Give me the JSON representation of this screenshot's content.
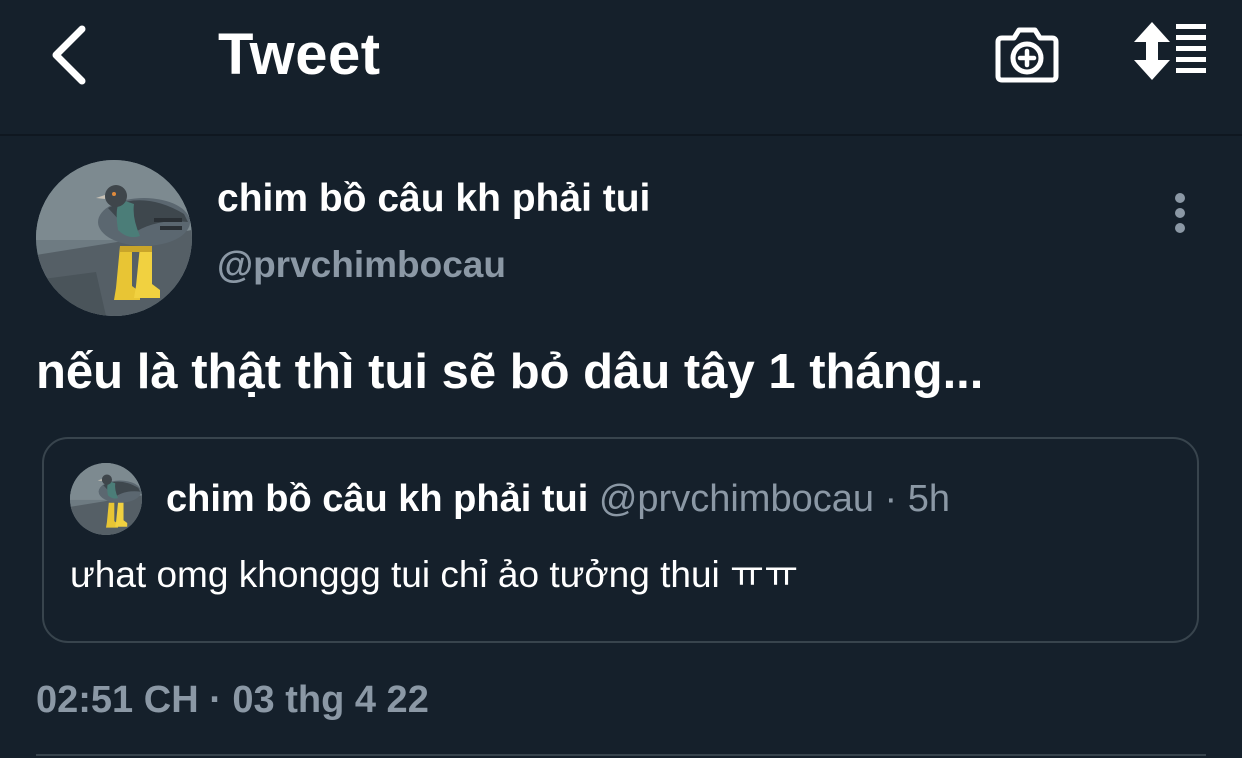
{
  "header": {
    "title": "Tweet",
    "back_icon": "chevron-left-icon",
    "camera_icon": "camera-add-icon",
    "sort_icon": "sort-list-icon"
  },
  "tweet": {
    "author_name": "chim bồ câu kh phải tui",
    "author_handle": "@prvchimbocau",
    "text": "nếu là thật thì tui sẽ bỏ dâu tây 1 tháng...",
    "timestamp": "02:51 CH · 03 thg 4 22"
  },
  "quoted_tweet": {
    "author_name": "chim bồ câu kh phải tui",
    "author_handle": "@prvchimbocau",
    "separator": "·",
    "time": "5h",
    "text": "ưhat omg khonggg tui chỉ ảo tưởng thui ㅠㅠ"
  },
  "colors": {
    "background": "#15202b",
    "text_primary": "#ffffff",
    "text_secondary": "#8b98a5",
    "border": "#38444d"
  }
}
